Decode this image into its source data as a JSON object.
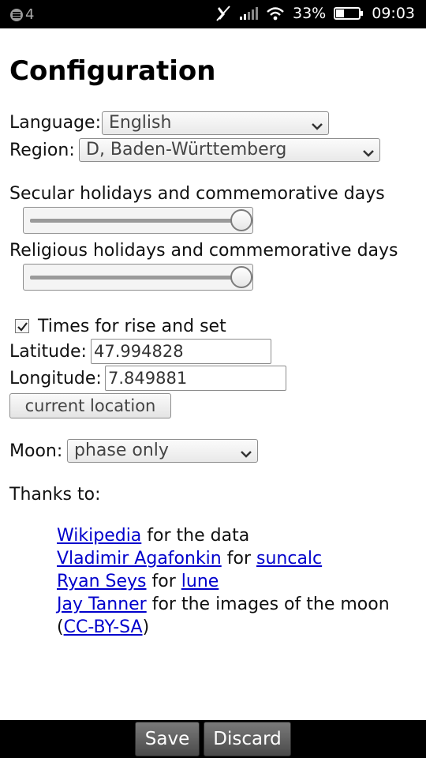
{
  "status_bar": {
    "notification_count": "4",
    "battery_percent": "33%",
    "time": "09:03",
    "icons": [
      "notification-icon",
      "mute-icon",
      "signal-icon",
      "wifi-icon",
      "battery-icon"
    ]
  },
  "page": {
    "title": "Configuration"
  },
  "language": {
    "label": "Language:",
    "value": "English"
  },
  "region": {
    "label": "Region:",
    "value": "D, Baden-Württemberg"
  },
  "secular": {
    "label": "Secular holidays and commemorative days",
    "level": 1.0
  },
  "religious": {
    "label": "Religious holidays and commemorative days",
    "level": 1.0
  },
  "rise_set": {
    "label": "Times for rise and set",
    "checked": true
  },
  "latitude": {
    "label": "Latitude:",
    "value": "47.994828"
  },
  "longitude": {
    "label": "Longitude:",
    "value": "7.849881"
  },
  "current_location": {
    "label": "current location"
  },
  "moon": {
    "label": "Moon:",
    "value": "phase only"
  },
  "thanks": {
    "label": "Thanks to:",
    "lines": [
      {
        "link": "Wikipedia",
        "text": " for the data"
      },
      {
        "link": "Vladimir Agafonkin",
        "text": " for ",
        "link2": "suncalc"
      },
      {
        "link": "Ryan Seys",
        "text": " for ",
        "link2": "lune"
      },
      {
        "link": "Jay Tanner",
        "text": " for the images of the moon"
      },
      {
        "pre": "(",
        "link": "CC-BY-SA",
        "post": ")"
      }
    ]
  },
  "footer": {
    "save": "Save",
    "discard": "Discard"
  }
}
